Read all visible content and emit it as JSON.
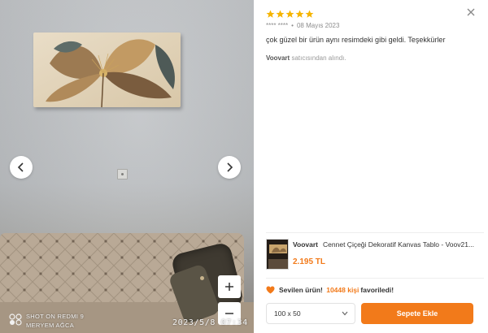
{
  "photo": {
    "watermark_brand": "SHOT ON REDMI 9",
    "watermark_author": "MERYEM AĞCA",
    "timestamp": "2023/5/8  07:34",
    "icons": {
      "prev": "chevron-left-icon",
      "next": "chevron-right-icon",
      "zoom_in": "plus-icon",
      "zoom_out": "minus-icon"
    }
  },
  "review": {
    "rating": 5,
    "max_rating": 5,
    "reviewer": "**** ****",
    "date": "08 Mayıs 2023",
    "text": "çok güzel bir ürün aynı resimdeki gibi geldi. Teşekkürler",
    "seller_name": "Voovart",
    "seller_suffix": "satıcısından alındı."
  },
  "product": {
    "brand": "Voovart",
    "title": "Cennet Çiçeği Dekoratif Kanvas Tablo - Voov21...",
    "price": "2.195 TL"
  },
  "favorite": {
    "prefix": "Sevilen ürün!",
    "count": "10448 kişi",
    "suffix": "favoriledi!"
  },
  "size_select": {
    "value": "100 x 50"
  },
  "actions": {
    "add_to_cart": "Sepete Ekle"
  },
  "colors": {
    "accent": "#f27a1a",
    "star": "#f5b400"
  }
}
